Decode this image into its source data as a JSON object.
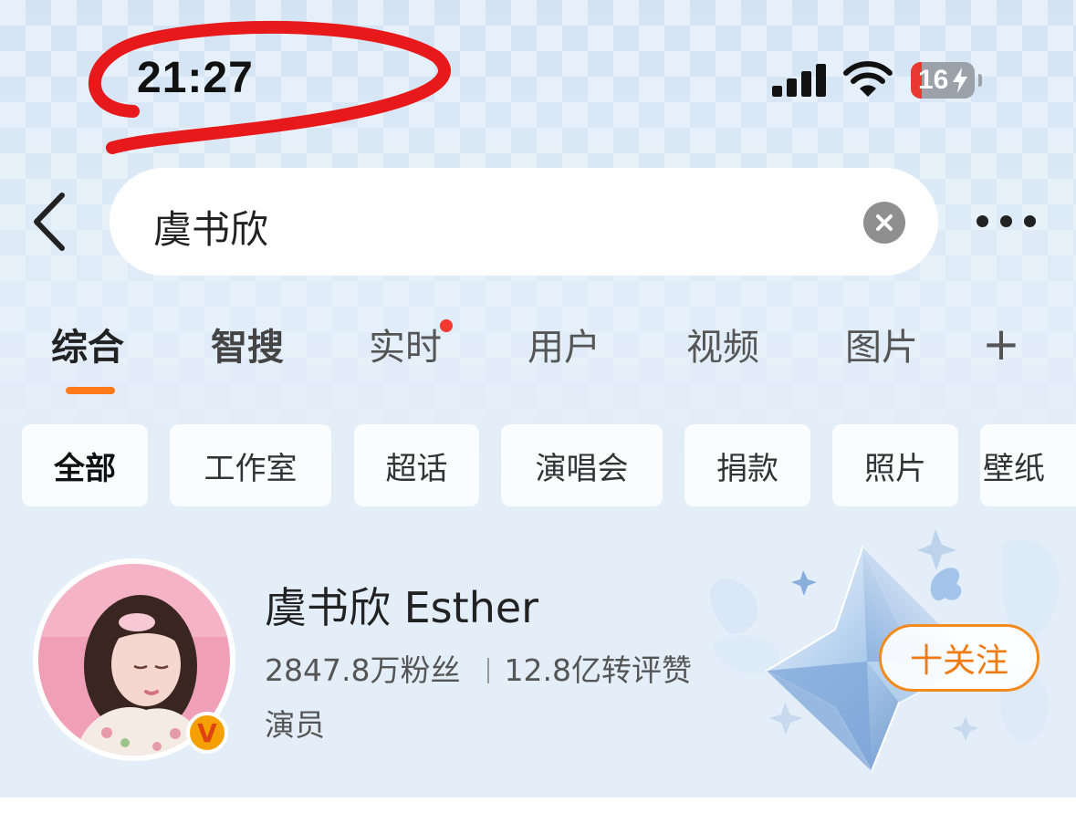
{
  "status_bar": {
    "time": "21:27",
    "battery": "16",
    "icons": [
      "cellular-signal-icon",
      "wifi-icon",
      "battery-charging-icon"
    ]
  },
  "search": {
    "query": "虞书欣",
    "icons": [
      "back-arrow-icon",
      "clear-icon",
      "more-icon"
    ]
  },
  "tabs": [
    {
      "label": "综合",
      "active": true
    },
    {
      "label": "智搜"
    },
    {
      "label": "实时",
      "dot": true
    },
    {
      "label": "用户"
    },
    {
      "label": "视频"
    },
    {
      "label": "图片"
    }
  ],
  "tab_add": "+",
  "chips": [
    "全部",
    "工作室",
    "超话",
    "演唱会",
    "捐款",
    "照片",
    "壁纸"
  ],
  "profile": {
    "name": "虞书欣 Esther",
    "followers": "2847.8万粉丝",
    "interactions": "12.8亿转评赞",
    "role": "演员",
    "verified_badge": "V",
    "follow_button": "十关注"
  },
  "colors": {
    "accent_orange": "#ff7a1a",
    "notification_red": "#f23a30",
    "battery_red": "#e8382f"
  }
}
